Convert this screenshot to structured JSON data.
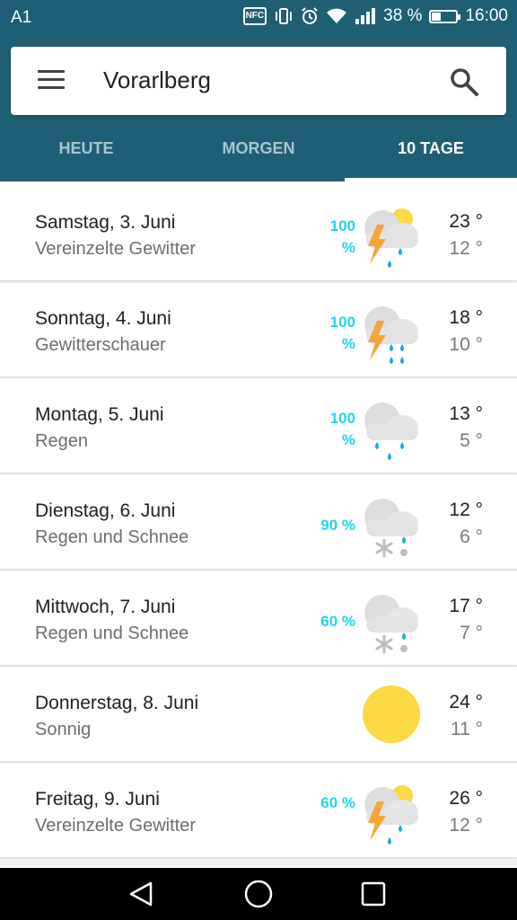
{
  "status_bar": {
    "carrier": "A1",
    "icons": [
      "nfc-icon",
      "vibrate-icon",
      "alarm-icon",
      "wifi-icon",
      "signal-icon",
      "battery-icon"
    ],
    "nfc_label": "NFC",
    "battery_percent": "38 %",
    "battery_level": 0.38,
    "time": "16:00"
  },
  "app_bar": {
    "location": "Vorarlberg",
    "menu_icon": "menu-icon",
    "search_icon": "search-icon",
    "tabs": [
      {
        "label": "HEUTE",
        "active": false
      },
      {
        "label": "MORGEN",
        "active": false
      },
      {
        "label": "10 TAGE",
        "active": true
      }
    ]
  },
  "days": [
    {
      "day": "Samstag, 3. Juni",
      "desc": "Vereinzelte Gewitter",
      "precip_value": "100",
      "precip_unit": "%",
      "icon": "thunderstorm-sun-icon",
      "high": "23 °",
      "low": "12 °"
    },
    {
      "day": "Sonntag, 4. Juni",
      "desc": "Gewitterschauer",
      "precip_value": "100",
      "precip_unit": "%",
      "icon": "thunderstorm-rain-icon",
      "high": "18 °",
      "low": "10 °"
    },
    {
      "day": "Montag, 5. Juni",
      "desc": "Regen",
      "precip_value": "100",
      "precip_unit": "%",
      "icon": "rain-icon",
      "high": "13 °",
      "low": "5 °"
    },
    {
      "day": "Dienstag, 6. Juni",
      "desc": "Regen und Schnee",
      "precip_value": "90 %",
      "precip_unit": "",
      "icon": "rain-snow-icon",
      "high": "12 °",
      "low": "6 °"
    },
    {
      "day": "Mittwoch, 7. Juni",
      "desc": "Regen und Schnee",
      "precip_value": "60 %",
      "precip_unit": "",
      "icon": "rain-snow-icon",
      "high": "17 °",
      "low": "7 °"
    },
    {
      "day": "Donnerstag, 8. Juni",
      "desc": "Sonnig",
      "precip_value": "",
      "precip_unit": "",
      "icon": "sun-icon",
      "high": "24 °",
      "low": "11 °"
    },
    {
      "day": "Freitag, 9. Juni",
      "desc": "Vereinzelte Gewitter",
      "precip_value": "60 %",
      "precip_unit": "",
      "icon": "thunderstorm-sun-icon",
      "high": "26 °",
      "low": "12 °"
    }
  ],
  "nav_bar": {
    "buttons": [
      "back-icon",
      "home-icon",
      "recents-icon"
    ]
  },
  "colors": {
    "app_bar": "#1e5f75",
    "precip_accent": "#1fd5ea",
    "sun": "#fcd843",
    "lightning": "#f4a63b",
    "rain_drop": "#1ba9db",
    "cloud": "#e0e0e0"
  }
}
